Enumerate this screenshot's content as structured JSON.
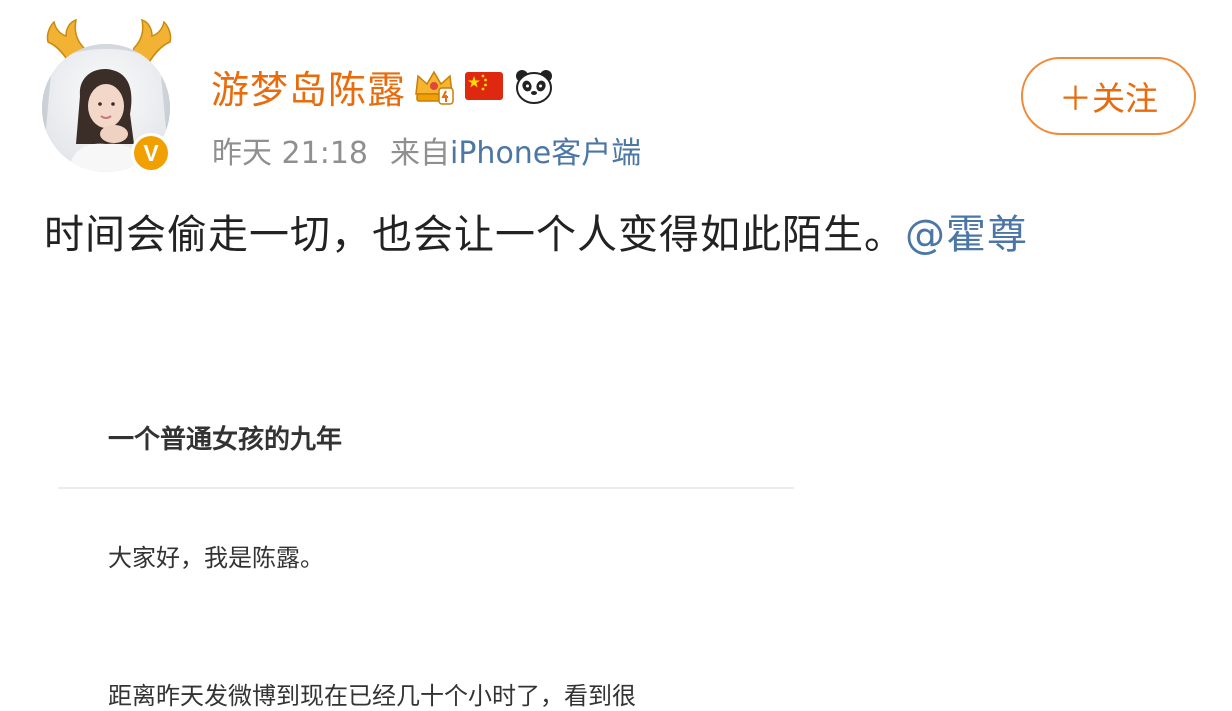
{
  "post": {
    "username": "游梦岛陈露",
    "verified_mark": "V",
    "timestamp": "昨天 21:18",
    "source_prefix": "来自",
    "source": "iPhone客户端",
    "follow_label": "＋关注",
    "text": "时间会偷走一切，也会让一个人变得如此陌生。",
    "mention": "@霍尊"
  },
  "badges": [
    "crown-vip-icon",
    "china-flag-icon",
    "panda-icon"
  ],
  "article": {
    "title": "一个普通女孩的九年",
    "paragraph_1": "大家好，我是陈露。",
    "paragraph_2_partial": "距离昨天发微博到现在已经几十个小时了，看到很"
  },
  "colors": {
    "username": "#e86b0c",
    "link": "#4b76a6",
    "meta": "#8f8f8f",
    "follow_border": "#ef8a3a",
    "verified": "#f0a000"
  }
}
